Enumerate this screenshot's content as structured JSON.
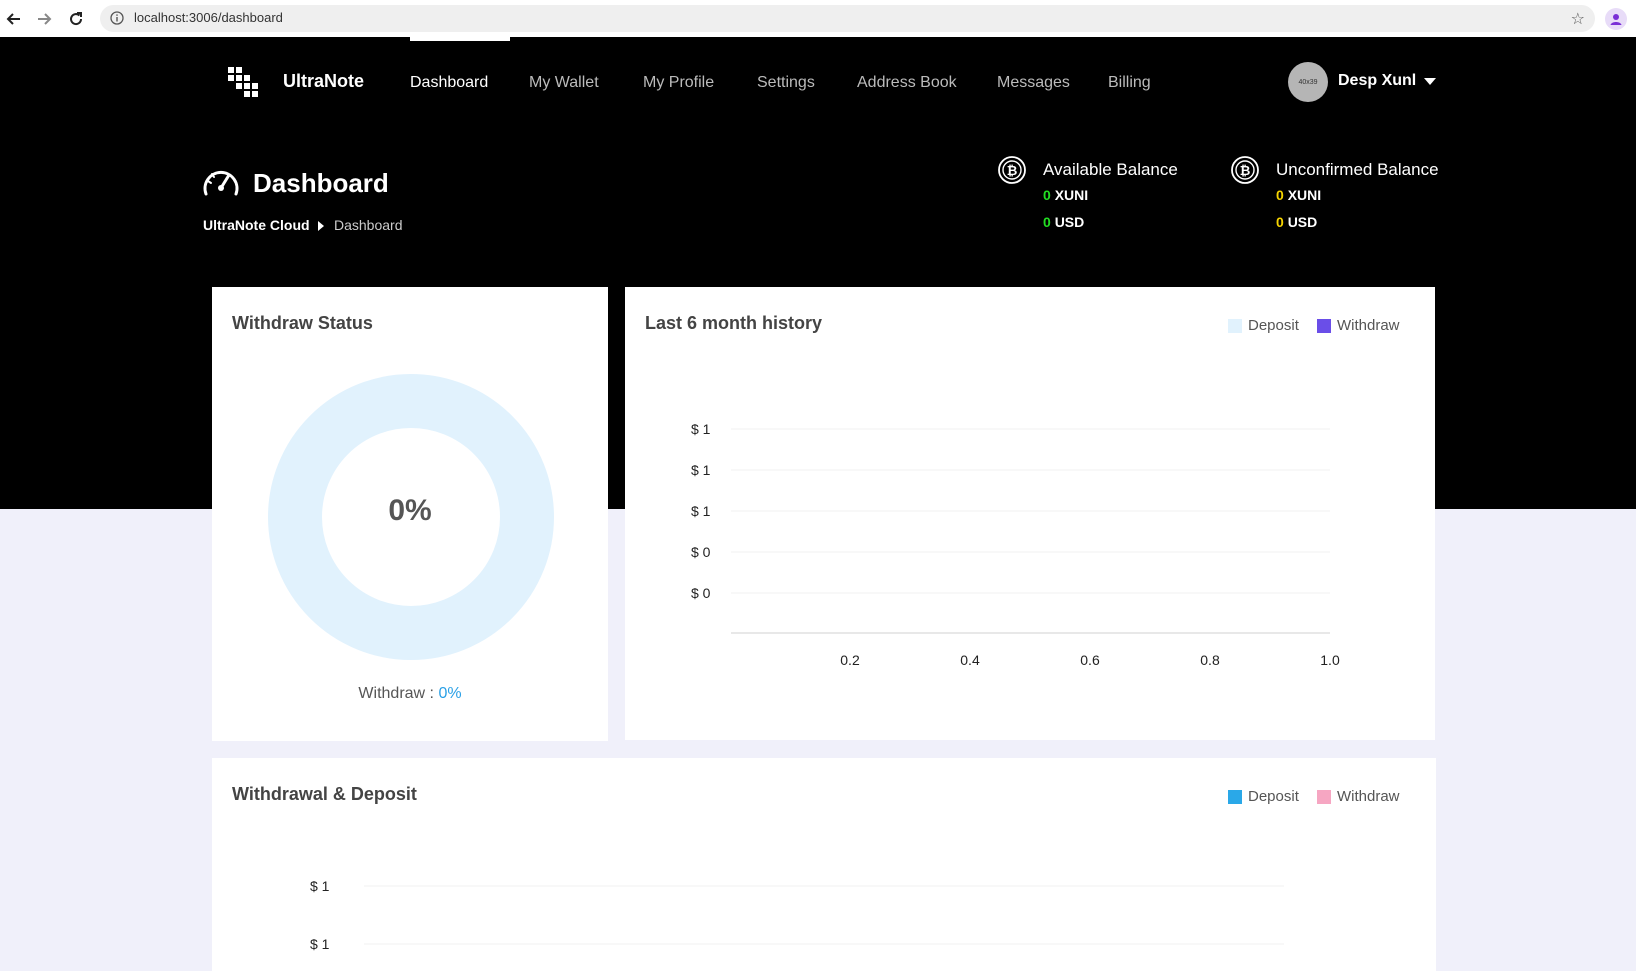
{
  "browser": {
    "url": "localhost:3006/dashboard"
  },
  "nav": {
    "brand": "UltraNote",
    "items": [
      {
        "label": "Dashboard",
        "active": true
      },
      {
        "label": "My Wallet"
      },
      {
        "label": "My Profile"
      },
      {
        "label": "Settings"
      },
      {
        "label": "Address Book"
      },
      {
        "label": "Messages"
      },
      {
        "label": "Billing"
      }
    ],
    "avatar_placeholder": "40x39",
    "user_name": "Desp Xunl"
  },
  "header": {
    "title": "Dashboard",
    "breadcrumb": [
      "UltraNote Cloud",
      "Dashboard"
    ],
    "available": {
      "title": "Available Balance",
      "xuni_amount": "0",
      "xuni_unit": "XUNI",
      "usd_amount": "0",
      "usd_unit": "USD",
      "color": "#22dd22"
    },
    "unconfirmed": {
      "title": "Unconfirmed Balance",
      "xuni_amount": "0",
      "xuni_unit": "XUNI",
      "usd_amount": "0",
      "usd_unit": "USD",
      "color": "#f5d300"
    }
  },
  "withdraw_status": {
    "title": "Withdraw Status",
    "percent_text": "0%",
    "caption_label": "Withdraw :",
    "caption_value": "0%"
  },
  "history": {
    "title": "Last 6 month history",
    "legend": [
      {
        "label": "Deposit",
        "color": "#e1f2fd"
      },
      {
        "label": "Withdraw",
        "color": "#6a4ee8"
      }
    ]
  },
  "withdrawal_deposit": {
    "title": "Withdrawal & Deposit",
    "legend": [
      {
        "label": "Deposit",
        "color": "#2aa8e8"
      },
      {
        "label": "Withdraw",
        "color": "#f6a6c2"
      }
    ]
  },
  "chart_data": [
    {
      "type": "pie",
      "title": "Withdraw Status",
      "values": [
        0
      ],
      "labels": [
        "Withdraw"
      ],
      "center_label": "0%"
    },
    {
      "type": "bar",
      "title": "Last 6 month history",
      "series": [
        {
          "name": "Deposit",
          "values": []
        },
        {
          "name": "Withdraw",
          "values": []
        }
      ],
      "x_ticks": [
        "0.2",
        "0.4",
        "0.6",
        "0.8",
        "1.0"
      ],
      "y_ticks": [
        "$ 1",
        "$ 1",
        "$ 1",
        "$ 0",
        "$ 0"
      ],
      "legend_position": "top-right",
      "grid": true
    },
    {
      "type": "bar",
      "title": "Withdrawal & Deposit",
      "series": [
        {
          "name": "Deposit",
          "values": []
        },
        {
          "name": "Withdraw",
          "values": []
        }
      ],
      "y_ticks": [
        "$ 1",
        "$ 1"
      ],
      "legend_position": "top-right",
      "grid": true
    }
  ]
}
